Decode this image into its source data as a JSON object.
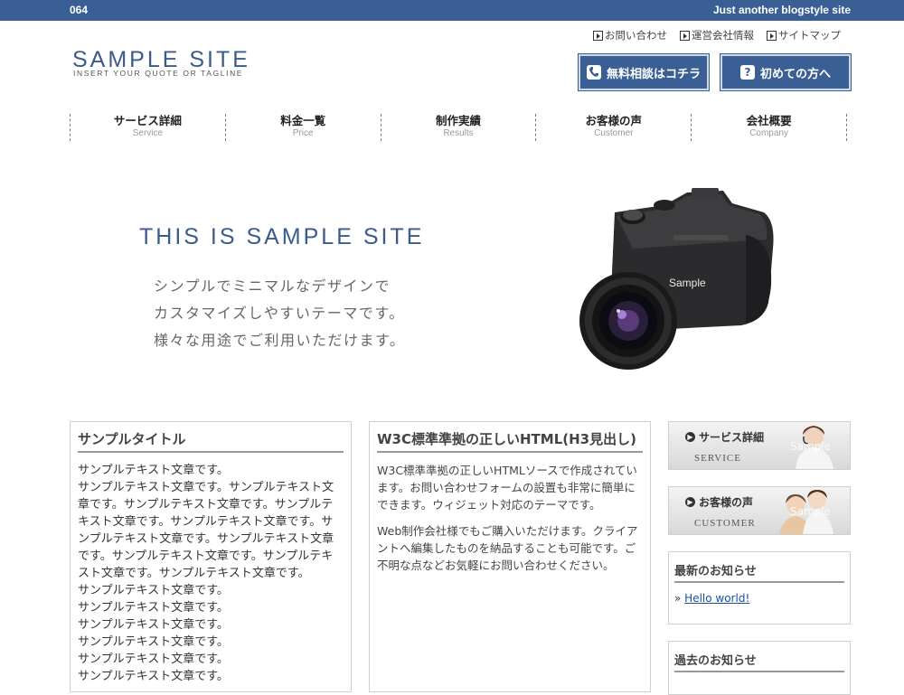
{
  "topbar": {
    "number": "064",
    "tagline": "Just another blogstyle site"
  },
  "header": {
    "logo_title": "SAMPLE SITE",
    "logo_tagline": "INSERT YOUR QUOTE OR TAGLINE",
    "links": [
      "お問い合わせ",
      "運営会社情報",
      "サイトマップ"
    ],
    "btn_consult": "無料相談はコチラ",
    "btn_first": "初めての方へ"
  },
  "nav": [
    {
      "jp": "サービス詳細",
      "en": "Service"
    },
    {
      "jp": "料金一覧",
      "en": "Price"
    },
    {
      "jp": "制作実績",
      "en": "Results"
    },
    {
      "jp": "お客様の声",
      "en": "Customer"
    },
    {
      "jp": "会社概要",
      "en": "Company"
    }
  ],
  "hero": {
    "title": "THIS IS SAMPLE SITE",
    "lines": [
      "シンプルでミニマルなデザインで",
      "カスタマイズしやすいテーマです。",
      "様々な用途でご利用いただけます。"
    ],
    "watermark": "Sample"
  },
  "col1": {
    "title": "サンプルタイトル",
    "lines": [
      "サンプルテキスト文章です。",
      "サンプルテキスト文章です。サンプルテキスト文",
      "章です。サンプルテキスト文章です。サンプルテ",
      "キスト文章です。サンプルテキスト文章です。サ",
      "ンプルテキスト文章です。サンプルテキスト文章",
      "です。サンプルテキスト文章です。サンプルテキ",
      "スト文章です。サンプルテキスト文章です。",
      "サンプルテキスト文章です。",
      "サンプルテキスト文章です。",
      "サンプルテキスト文章です。",
      "サンプルテキスト文章です。",
      "サンプルテキスト文章です。",
      "サンプルテキスト文章です。"
    ]
  },
  "col2": {
    "title": "W3C標準準拠の正しいHTML(H3見出し)",
    "p1": "W3C標準準拠の正しいHTMLソースで作成されています。お問い合わせフォームの設置も非常に簡単にできます。ウィジェット対応のテーマです。",
    "p2": "Web制作会社様でもご購入いただけます。クライアントへ編集したものを納品することも可能です。ご不明な点などお気軽にお問い合わせください。"
  },
  "sidebar": {
    "banner1_title": "サービス詳細",
    "banner1_sub": "SERVICE",
    "banner2_title": "お客様の声",
    "banner2_sub": "CUSTOMER",
    "watermark": "Sample",
    "news_title": "最新のお知らせ",
    "news_link": "Hello world!",
    "past_title": "過去のお知らせ"
  },
  "colors": {
    "accent": "#3a5f95",
    "link": "#1a4fa0"
  }
}
